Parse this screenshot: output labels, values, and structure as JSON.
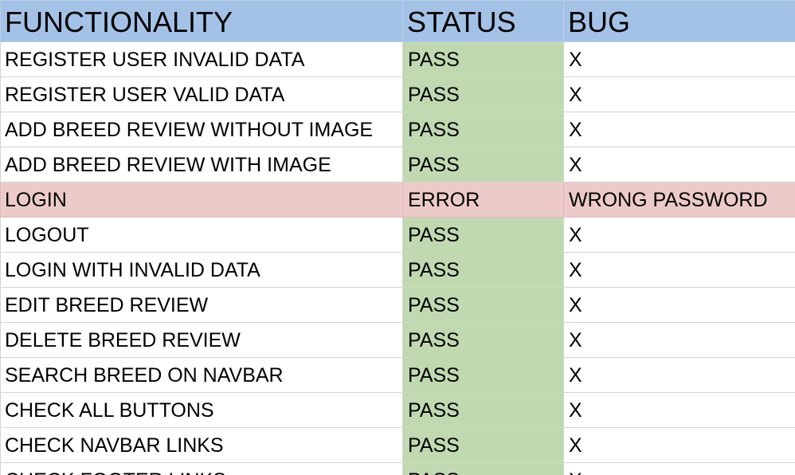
{
  "table": {
    "headers": {
      "functionality": "FUNCTIONALITY",
      "status": "STATUS",
      "bug": "BUG"
    },
    "rows": [
      {
        "functionality": "REGISTER USER INVALID DATA",
        "status": "PASS",
        "bug": "X"
      },
      {
        "functionality": "REGISTER USER VALID DATA",
        "status": "PASS",
        "bug": "X"
      },
      {
        "functionality": "ADD BREED REVIEW WITHOUT IMAGE",
        "status": "PASS",
        "bug": "X"
      },
      {
        "functionality": "ADD BREED REVIEW WITH IMAGE",
        "status": "PASS",
        "bug": "X"
      },
      {
        "functionality": "LOGIN",
        "status": "ERROR",
        "bug": "WRONG PASSWORD"
      },
      {
        "functionality": "LOGOUT",
        "status": "PASS",
        "bug": "X"
      },
      {
        "functionality": "LOGIN WITH INVALID DATA",
        "status": "PASS",
        "bug": "X"
      },
      {
        "functionality": "EDIT BREED REVIEW",
        "status": "PASS",
        "bug": "X"
      },
      {
        "functionality": "DELETE BREED REVIEW",
        "status": "PASS",
        "bug": "X"
      },
      {
        "functionality": "SEARCH BREED ON NAVBAR",
        "status": "PASS",
        "bug": "X"
      },
      {
        "functionality": "CHECK ALL BUTTONS",
        "status": "PASS",
        "bug": "X"
      },
      {
        "functionality": "CHECK NAVBAR LINKS",
        "status": "PASS",
        "bug": "X"
      },
      {
        "functionality": "CHECK FOOTER LINKS",
        "status": "PASS",
        "bug": "X"
      }
    ]
  },
  "colors": {
    "header_bg": "#a4c2e6",
    "pass_bg": "#c1d9b0",
    "error_row_bg": "#edcaca",
    "gridline": "#d4d4d4"
  }
}
